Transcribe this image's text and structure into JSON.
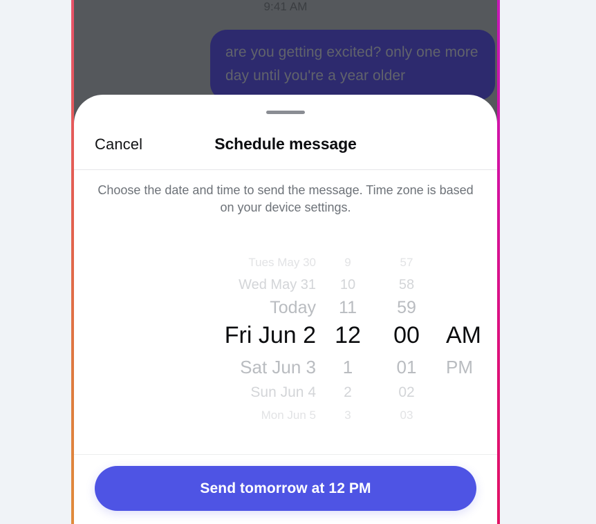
{
  "conversation": {
    "timestamp": "9:41 AM",
    "message": "are you getting excited? only one more day until you're a year older"
  },
  "sheet": {
    "cancel_label": "Cancel",
    "title": "Schedule message",
    "description": "Choose the date and time to send the message. Time zone is based on your device settings.",
    "grabber": "sheet-grabber"
  },
  "picker": {
    "date": {
      "label": "date",
      "selected": "Fri Jun 2",
      "items": [
        "Tues May 30",
        "Wed May 31",
        "Today",
        "Fri Jun 2",
        "Sat Jun 3",
        "Sun Jun 4",
        "Mon Jun 5"
      ]
    },
    "hour": {
      "label": "hour",
      "selected": "12",
      "items": [
        "9",
        "10",
        "11",
        "12",
        "1",
        "2",
        "3"
      ]
    },
    "minute": {
      "label": "minute",
      "selected": "00",
      "items": [
        "57",
        "58",
        "59",
        "00",
        "01",
        "02",
        "03"
      ]
    },
    "period": {
      "label": "period",
      "selected": "AM",
      "items": [
        "",
        "",
        "",
        "AM",
        "PM",
        "",
        ""
      ]
    }
  },
  "footer": {
    "send_label": "Send tomorrow at 12 PM"
  },
  "colors": {
    "accent": "#4e54e4",
    "bubble": "#2d2a6e",
    "backdrop": "#55585c",
    "page_background": "#f0f3f7",
    "frame_left_top": "#e8536a",
    "frame_left_bottom": "#e08b3c",
    "frame_right_top": "#c718b8",
    "frame_right_bottom": "#e21365"
  }
}
